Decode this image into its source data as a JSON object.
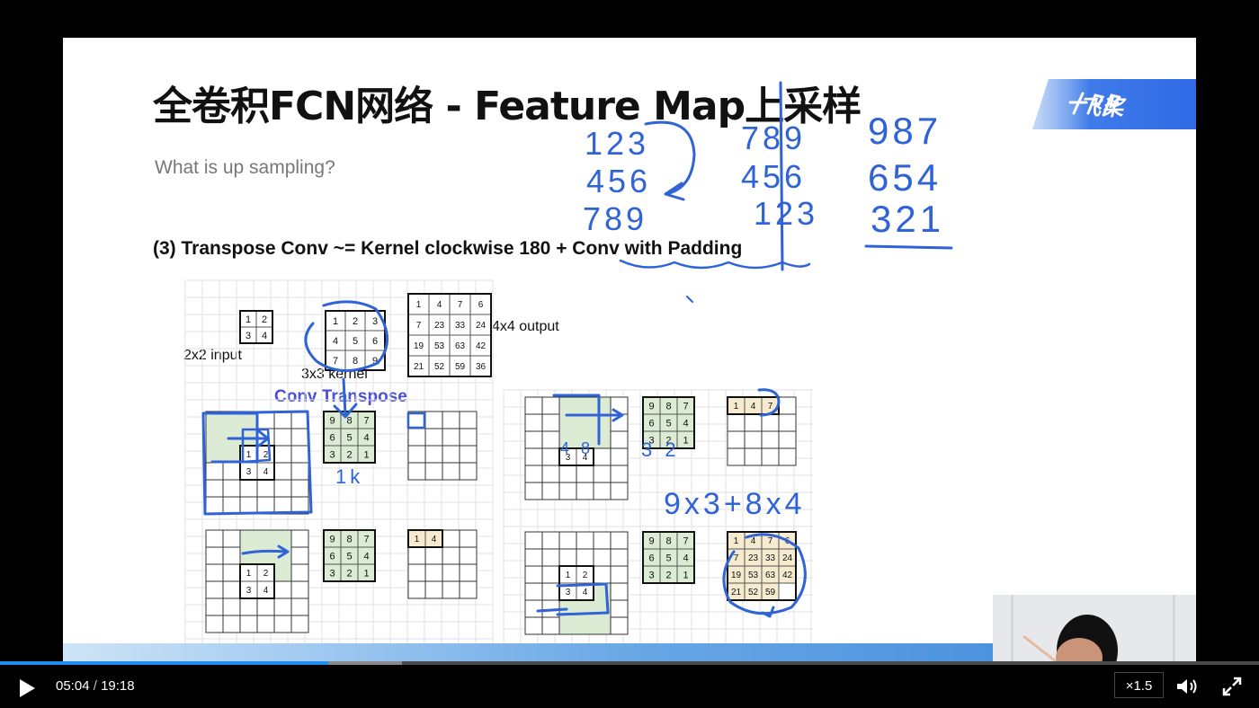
{
  "slide": {
    "title": "全卷积FCN网络 - Feature Map上采样",
    "subtitle": "What is up sampling?",
    "section_heading": "(3) Transpose Conv ~= Kernel clockwise 180 + Conv with Padding",
    "logo_text": "飞桨",
    "labels": {
      "input": "2x2 input",
      "kernel": "3x3 kernel",
      "output": "4x4 output",
      "conv_transpose": "Conv Transpose"
    },
    "input_matrix": [
      [
        "1",
        "2"
      ],
      [
        "3",
        "4"
      ]
    ],
    "kernel_matrix": [
      [
        "1",
        "2",
        "3"
      ],
      [
        "4",
        "5",
        "6"
      ],
      [
        "7",
        "8",
        "9"
      ]
    ],
    "kernel_rotated": [
      [
        "9",
        "8",
        "7"
      ],
      [
        "6",
        "5",
        "4"
      ],
      [
        "3",
        "2",
        "1"
      ]
    ],
    "output_matrix": [
      [
        "1",
        "4",
        "7",
        "6"
      ],
      [
        "7",
        "23",
        "33",
        "24"
      ],
      [
        "19",
        "53",
        "63",
        "42"
      ],
      [
        "21",
        "52",
        "59",
        "36"
      ]
    ],
    "partial_output_a": [
      "1",
      "4"
    ],
    "partial_output_b": [
      "1",
      "4",
      "7"
    ],
    "partial_output_c": [
      [
        "1",
        "4",
        "7",
        "6"
      ],
      [
        "7",
        "23",
        "33",
        "24"
      ],
      [
        "19",
        "53",
        "63",
        "42"
      ],
      [
        "21",
        "52",
        "59"
      ]
    ],
    "handwriting": {
      "m1": [
        "123",
        "456",
        "789"
      ],
      "m2": [
        "789",
        "456",
        "123"
      ],
      "m3": [
        "987",
        "654",
        "321"
      ],
      "formula": "9x3+8x4",
      "note1": "4 8",
      "note2": "3 2",
      "note3": "1k"
    }
  },
  "player": {
    "current_time": "05:04",
    "duration": "19:18",
    "progress": 0.261,
    "buffered": 0.319,
    "speed_label": "×1.5",
    "accent_color": "#1f8ef1",
    "icons": {
      "play": "play-icon",
      "volume": "volume-icon",
      "fullscreen": "fullscreen-icon"
    }
  }
}
